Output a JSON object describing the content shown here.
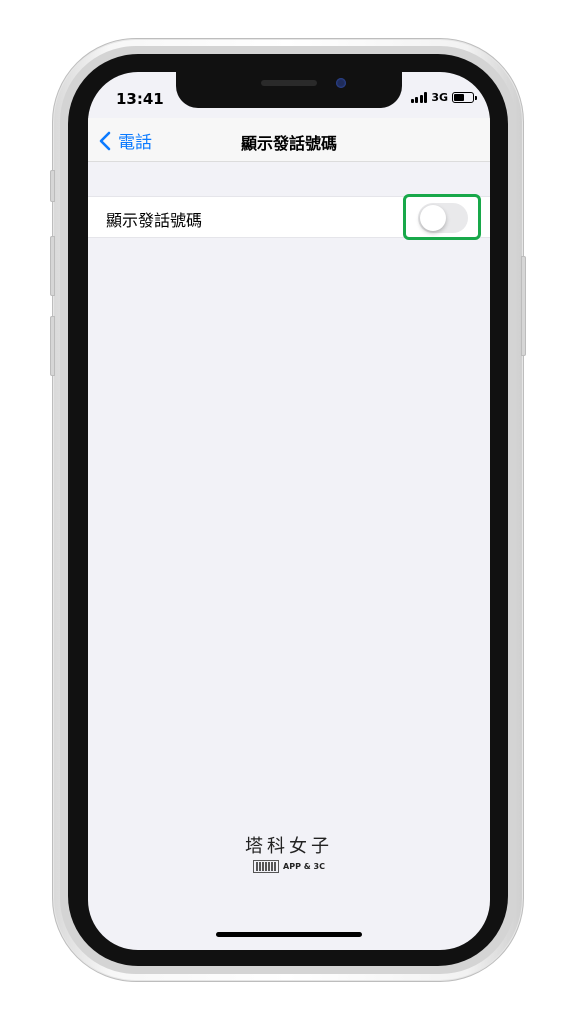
{
  "status_bar": {
    "time": "13:41",
    "network": "3G",
    "signal_bars": 4,
    "battery_level": 0.6
  },
  "navbar": {
    "back_label": "電話",
    "title": "顯示發話號碼"
  },
  "setting": {
    "label": "顯示發話號碼",
    "toggle_on": false
  },
  "watermark": {
    "title": "塔科女子",
    "subtitle": "APP & 3C"
  },
  "colors": {
    "accent": "#0a7aff",
    "highlight": "#18a84a",
    "background": "#f2f2f7",
    "toggle_off": "#e9e9eb"
  }
}
